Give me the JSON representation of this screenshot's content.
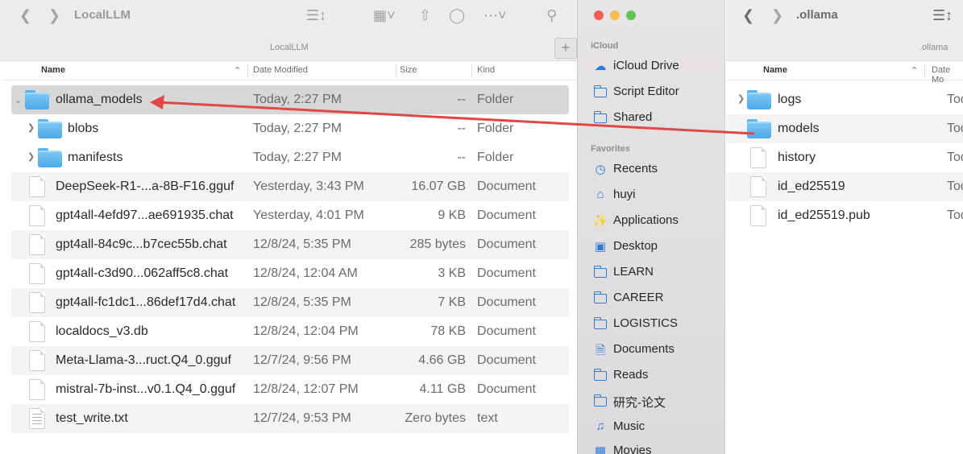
{
  "left_window": {
    "title": "LocalLLM",
    "path_label": "LocalLLM",
    "columns": {
      "name": "Name",
      "date": "Date Modified",
      "size": "Size",
      "kind": "Kind"
    },
    "rows": [
      {
        "name": "ollama_models",
        "date": "Today, 2:27 PM",
        "size": "--",
        "kind": "Folder",
        "icon": "folder-icon"
      },
      {
        "name": "blobs",
        "date": "Today, 2:27 PM",
        "size": "--",
        "kind": "Folder",
        "icon": "folder-icon"
      },
      {
        "name": "manifests",
        "date": "Today, 2:27 PM",
        "size": "--",
        "kind": "Folder",
        "icon": "folder-icon"
      },
      {
        "name": "DeepSeek-R1-...a-8B-F16.gguf",
        "date": "Yesterday, 3:43 PM",
        "size": "16.07 GB",
        "kind": "Document",
        "icon": "document-icon"
      },
      {
        "name": "gpt4all-4efd97...ae691935.chat",
        "date": "Yesterday, 4:01 PM",
        "size": "9 KB",
        "kind": "Document",
        "icon": "document-icon"
      },
      {
        "name": "gpt4all-84c9c...b7cec55b.chat",
        "date": "12/8/24, 5:35 PM",
        "size": "285 bytes",
        "kind": "Document",
        "icon": "document-icon"
      },
      {
        "name": "gpt4all-c3d90...062aff5c8.chat",
        "date": "12/8/24, 12:04 AM",
        "size": "3 KB",
        "kind": "Document",
        "icon": "document-icon"
      },
      {
        "name": "gpt4all-fc1dc1...86def17d4.chat",
        "date": "12/8/24, 5:35 PM",
        "size": "7 KB",
        "kind": "Document",
        "icon": "document-icon"
      },
      {
        "name": "localdocs_v3.db",
        "date": "12/8/24, 12:04 PM",
        "size": "78 KB",
        "kind": "Document",
        "icon": "document-icon"
      },
      {
        "name": "Meta-Llama-3...ruct.Q4_0.gguf",
        "date": "12/7/24, 9:56 PM",
        "size": "4.66 GB",
        "kind": "Document",
        "icon": "document-icon"
      },
      {
        "name": "mistral-7b-inst...v0.1.Q4_0.gguf",
        "date": "12/8/24, 12:07 PM",
        "size": "4.11 GB",
        "kind": "Document",
        "icon": "document-icon"
      },
      {
        "name": "test_write.txt",
        "date": "12/7/24, 9:53 PM",
        "size": "Zero bytes",
        "kind": "text",
        "icon": "text-document-icon"
      }
    ]
  },
  "sidebar": {
    "icloud_header": "iCloud",
    "icloud_items": [
      {
        "label": "iCloud Drive",
        "icon": "cloud-icon"
      },
      {
        "label": "Script Editor",
        "icon": "folder-icon"
      },
      {
        "label": "Shared",
        "icon": "shared-folder-icon"
      }
    ],
    "favorites_header": "Favorites",
    "favorites_items": [
      {
        "label": "Recents",
        "icon": "clock-icon"
      },
      {
        "label": "huyi",
        "icon": "home-icon"
      },
      {
        "label": "Applications",
        "icon": "applications-icon"
      },
      {
        "label": "Desktop",
        "icon": "desktop-icon"
      },
      {
        "label": "LEARN",
        "icon": "folder-icon"
      },
      {
        "label": "CAREER",
        "icon": "folder-icon"
      },
      {
        "label": "LOGISTICS",
        "icon": "folder-icon"
      },
      {
        "label": "Documents",
        "icon": "document-icon"
      },
      {
        "label": "Reads",
        "icon": "folder-icon"
      },
      {
        "label": "研究-论文",
        "icon": "folder-icon"
      },
      {
        "label": "Music",
        "icon": "music-icon"
      },
      {
        "label": "Movies",
        "icon": "movies-icon"
      }
    ]
  },
  "right_window": {
    "title": ".ollama",
    "path_label": ".ollama",
    "columns": {
      "name": "Name",
      "date": "Date Mo"
    },
    "rows": [
      {
        "name": "logs",
        "date": "Today",
        "icon": "folder-icon"
      },
      {
        "name": "models",
        "date": "Today",
        "icon": "folder-alias-icon"
      },
      {
        "name": "history",
        "date": "Today",
        "icon": "document-icon"
      },
      {
        "name": "id_ed25519",
        "date": "Today",
        "icon": "document-icon"
      },
      {
        "name": "id_ed25519.pub",
        "date": "Today",
        "icon": "document-icon"
      }
    ]
  },
  "colors": {
    "arrow": "#e04848",
    "folder": "#5eb4ec",
    "sidebar_accent": "#2f7bd9"
  }
}
